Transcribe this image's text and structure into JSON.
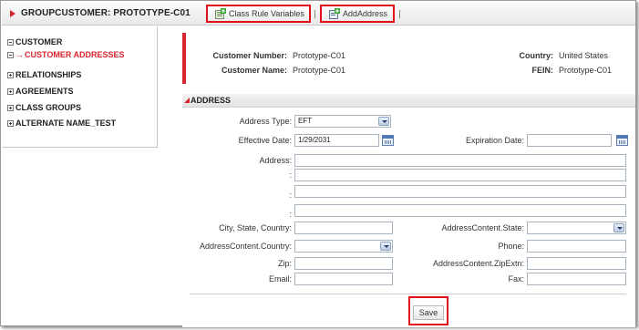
{
  "header": {
    "title": "GROUPCUSTOMER: PROTOTYPE-C01",
    "buttons": [
      {
        "label": "Class Rule Variables",
        "icon": "class-rule-variables-icon"
      },
      {
        "label": "AddAddress",
        "icon": "add-address-icon"
      }
    ]
  },
  "sidebar": {
    "items": [
      {
        "label": "CUSTOMER",
        "expanded": true
      },
      {
        "label": "CUSTOMER ADDRESSES",
        "active": true
      },
      {
        "label": "RELATIONSHIPS",
        "expanded": false
      },
      {
        "label": "AGREEMENTS",
        "expanded": false
      },
      {
        "label": "CLASS GROUPS",
        "expanded": false
      },
      {
        "label": "ALTERNATE NAME_TEST",
        "expanded": false
      }
    ]
  },
  "summary": {
    "customer_number_label": "Customer Number:",
    "customer_number": "Prototype-C01",
    "customer_name_label": "Customer Name:",
    "customer_name": "Prototype-C01",
    "country_label": "Country:",
    "country": "United States",
    "fein_label": "FEIN:",
    "fein": "Prototype-C01"
  },
  "address": {
    "section_title": "ADDRESS",
    "address_type_label": "Address Type:",
    "address_type_value": "EFT",
    "effective_date_label": "Effective Date:",
    "effective_date_value": "1/29/2031",
    "expiration_date_label": "Expiration Date:",
    "expiration_date_value": "",
    "address_label": "Address:",
    "address_line_sep": ":",
    "address_lines": [
      "",
      "",
      "",
      ""
    ],
    "city_state_country_label": "City, State, Country:",
    "city_state_country_value": "",
    "state_label": "AddressContent.State:",
    "state_value": "",
    "country_label": "AddressContent.Country:",
    "country_value": "",
    "phone_label": "Phone:",
    "phone_value": "",
    "zip_label": "Zip:",
    "zip_value": "",
    "zip_extn_label": "AddressContent.ZipExtn:",
    "zip_extn_value": "",
    "email_label": "Email:",
    "email_value": "",
    "fax_label": "Fax:",
    "fax_value": "",
    "save_label": "Save"
  },
  "colors": {
    "accent_red": "#d8262f",
    "highlight_red": "#e0111a"
  }
}
